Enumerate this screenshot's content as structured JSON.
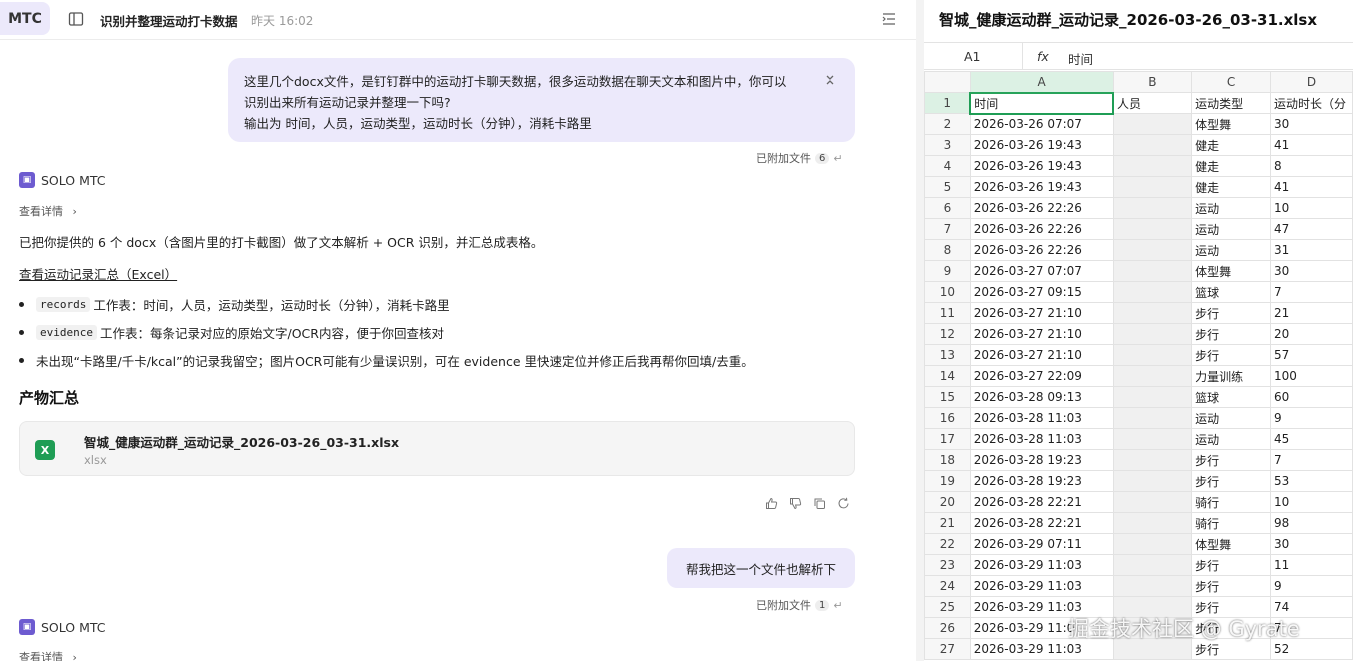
{
  "topbar": {
    "badge": "MTC",
    "title": "识别并整理运动打卡数据",
    "time": "昨天 16:02"
  },
  "messages": {
    "user1_line1": "这里几个docx文件，是钉钉群中的运动打卡聊天数据，很多运动数据在聊天文本和图片中，你可以",
    "user1_line2": "识别出来所有运动记录并整理一下吗?",
    "user1_line3": "输出为 时间，人员，运动类型，运动时长（分钟），消耗卡路里",
    "attach1_label": "已附加文件",
    "attach1_count": "6",
    "bot_name": "SOLO MTC",
    "detail_link": "查看详情",
    "reply": "已把你提供的 6 个 docx（含图片里的打卡截图）做了文本解析 + OCR 识别，并汇总成表格。",
    "excel_link": "查看运动记录汇总（Excel）",
    "bullet1_code": "records",
    "bullet1_text": "工作表：时间，人员，运动类型，运动时长（分钟），消耗卡路里",
    "bullet2_code": "evidence",
    "bullet2_text": "工作表：每条记录对应的原始文字/OCR内容，便于你回查核对",
    "bullet3_text": "未出现“卡路里/千卡/kcal”的记录我留空；图片OCR可能有少量误识别，可在 evidence 里快速定位并修正后我再帮你回填/去重。",
    "artifacts_title": "产物汇总",
    "file_name": "智城_健康运动群_运动记录_2026-03-26_03-31.xlsx",
    "file_type": "xlsx",
    "file_icon_letter": "X",
    "user2": "帮我把这一个文件也解析下",
    "attach2_label": "已附加文件",
    "attach2_count": "1",
    "bot_name2": "SOLO MTC",
    "detail_link2": "查看详情"
  },
  "sheet": {
    "title": "智城_健康运动群_运动记录_2026-03-26_03-31.xlsx",
    "cell_ref": "A1",
    "fx_label": "fx",
    "formula_value": "时间",
    "columns": [
      "A",
      "B",
      "C",
      "D"
    ],
    "header": [
      "时间",
      "人员",
      "运动类型",
      "运动时长（分"
    ],
    "rows": [
      [
        "2026-03-26 07:07",
        "",
        "体型舞",
        "30"
      ],
      [
        "2026-03-26 19:43",
        "",
        "健走",
        "41"
      ],
      [
        "2026-03-26 19:43",
        "",
        "健走",
        "8"
      ],
      [
        "2026-03-26 19:43",
        "",
        "健走",
        "41"
      ],
      [
        "2026-03-26 22:26",
        "",
        "运动",
        "10"
      ],
      [
        "2026-03-26 22:26",
        "",
        "运动",
        "47"
      ],
      [
        "2026-03-26 22:26",
        "",
        "运动",
        "31"
      ],
      [
        "2026-03-27 07:07",
        "",
        "体型舞",
        "30"
      ],
      [
        "2026-03-27 09:15",
        "",
        "篮球",
        "7"
      ],
      [
        "2026-03-27 21:10",
        "",
        "步行",
        "21"
      ],
      [
        "2026-03-27 21:10",
        "",
        "步行",
        "20"
      ],
      [
        "2026-03-27 21:10",
        "",
        "步行",
        "57"
      ],
      [
        "2026-03-27 22:09",
        "",
        "力量训练",
        "100"
      ],
      [
        "2026-03-28 09:13",
        "",
        "篮球",
        "60"
      ],
      [
        "2026-03-28 11:03",
        "",
        "运动",
        "9"
      ],
      [
        "2026-03-28 11:03",
        "",
        "运动",
        "45"
      ],
      [
        "2026-03-28 19:23",
        "",
        "步行",
        "7"
      ],
      [
        "2026-03-28 19:23",
        "",
        "步行",
        "53"
      ],
      [
        "2026-03-28 22:21",
        "",
        "骑行",
        "10"
      ],
      [
        "2026-03-28 22:21",
        "",
        "骑行",
        "98"
      ],
      [
        "2026-03-29 07:11",
        "",
        "体型舞",
        "30"
      ],
      [
        "2026-03-29 11:03",
        "",
        "步行",
        "11"
      ],
      [
        "2026-03-29 11:03",
        "",
        "步行",
        "9"
      ],
      [
        "2026-03-29 11:03",
        "",
        "步行",
        "74"
      ],
      [
        "2026-03-29 11:0",
        "",
        "步行",
        "7"
      ],
      [
        "2026-03-29 11:03",
        "",
        "步行",
        "52"
      ]
    ]
  },
  "watermark": "掘金技术社区 @ Gyrate"
}
